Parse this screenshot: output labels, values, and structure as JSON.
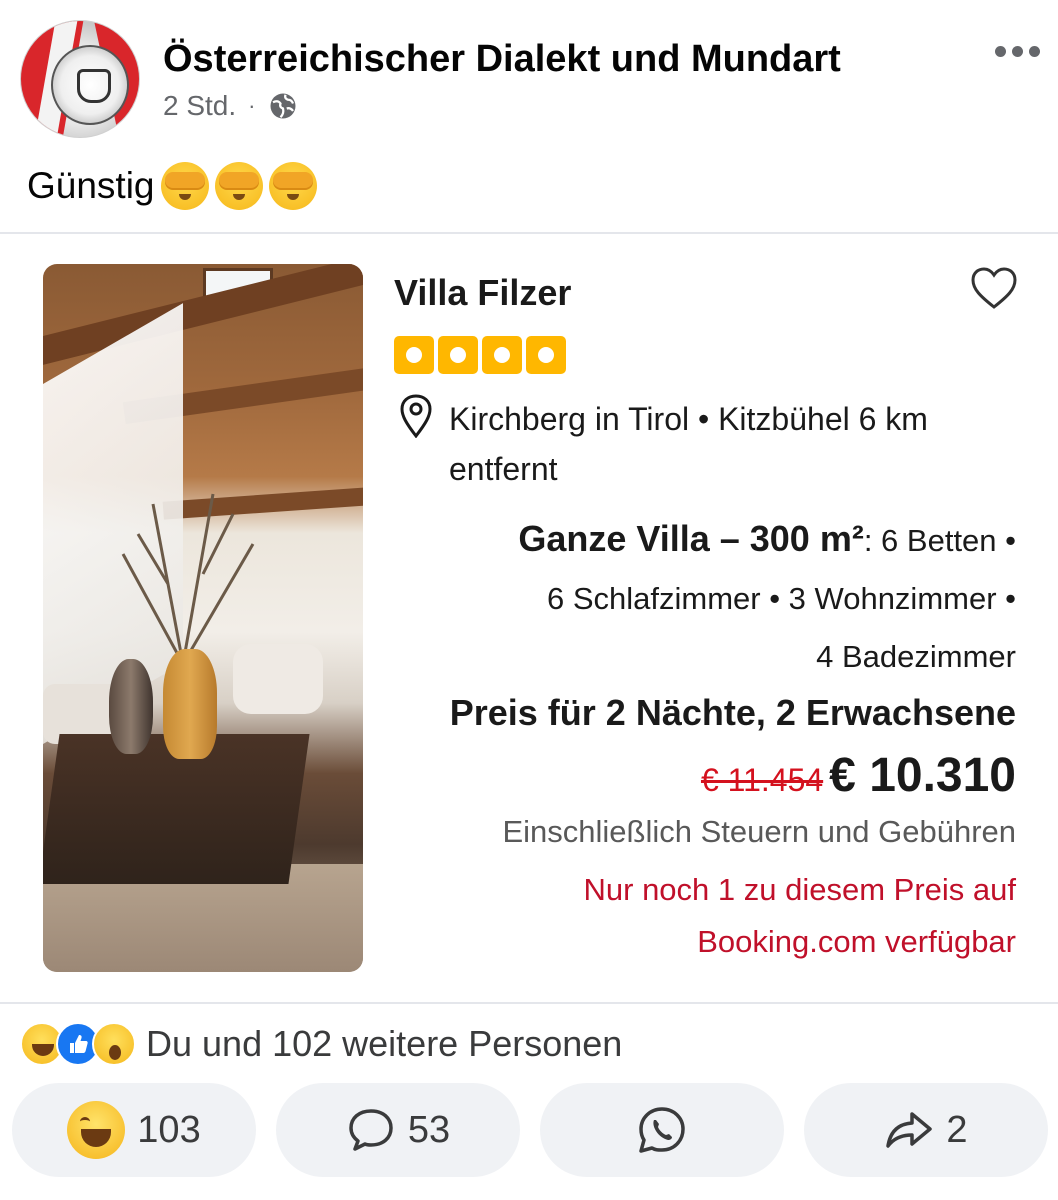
{
  "post": {
    "page_name": "Österreichischer Dialekt und Mundart",
    "time": "2 Std.",
    "separator": "·",
    "text": "Günstig"
  },
  "listing": {
    "name": "Villa Filzer",
    "rating_boxes": 4,
    "location_line1": "Kirchberg in Tirol • Kitzbühel 6 km",
    "location_line2": "entfernt",
    "type": "Ganze Villa – 300 m²",
    "details_inline": ": 6 Betten •",
    "details_line2": "6 Schlafzimmer • 3 Wohnzimmer •",
    "details_line3": "4 Badezimmer",
    "price_label": "Preis für 2 Nächte, 2 Erwachsene",
    "old_price": "€ 11.454",
    "new_price": "€ 10.310",
    "tax_note": "Einschließlich Steuern und Gebühren",
    "availability_line1": "Nur noch 1 zu diesem Preis auf",
    "availability_line2": "Booking.com verfügbar"
  },
  "reactions": {
    "summary": "Du und 102 weitere Personen",
    "icons": [
      "haha",
      "like",
      "wow"
    ]
  },
  "actions": {
    "reaction_count": "103",
    "comment_count": "53",
    "share_count": "2"
  },
  "colors": {
    "rating": "#ffb700",
    "old_price": "#d4111e",
    "availability": "#c0102a",
    "like_blue": "#1877f2"
  }
}
